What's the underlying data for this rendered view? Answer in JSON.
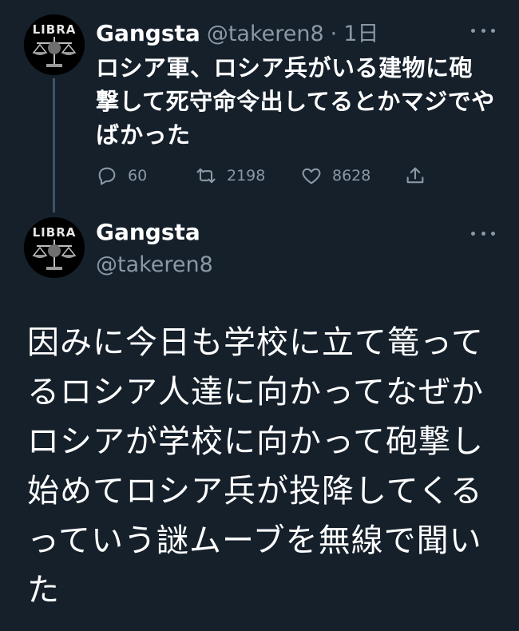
{
  "colors": {
    "background": "#15202b",
    "text_primary": "#ffffff",
    "text_secondary": "#8b98a5",
    "thread_line": "#3d5466"
  },
  "tweet1": {
    "avatar_text": "LIBRA",
    "display_name": "Gangsta",
    "handle": "@takeren8",
    "separator": "·",
    "time": "1日",
    "text": "ロシア軍、ロシア兵がいる建物に砲撃して死守命令出してるとかマジでやばかった",
    "actions": {
      "reply_icon": "reply-icon",
      "reply_count": "60",
      "retweet_icon": "retweet-icon",
      "retweet_count": "2198",
      "like_icon": "heart-icon",
      "like_count": "8628",
      "share_icon": "share-icon"
    },
    "more_icon": "more-icon"
  },
  "tweet2": {
    "avatar_text": "LIBRA",
    "display_name": "Gangsta",
    "handle": "@takeren8",
    "text": "因みに今日も学校に立て篭ってるロシア人達に向かってなぜかロシアが学校に向かって砲撃し始めてロシア兵が投降してくるっていう謎ムーブを無線で聞いた",
    "more_icon": "more-icon"
  }
}
